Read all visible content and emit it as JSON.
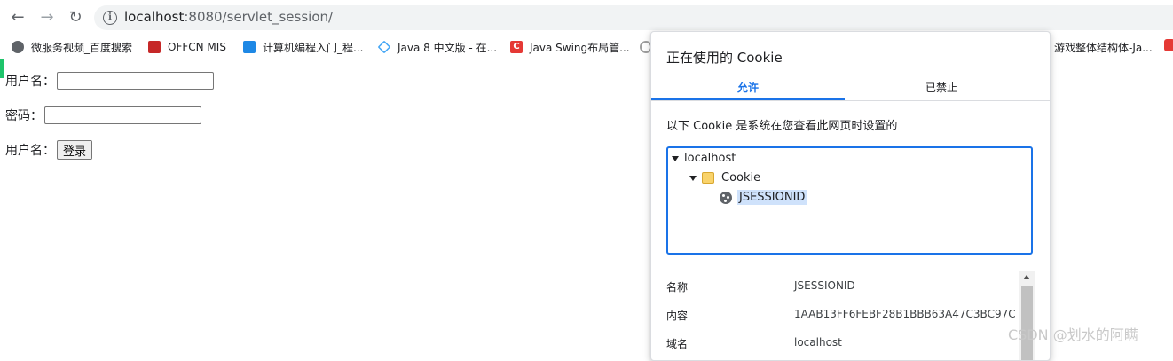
{
  "browser": {
    "url_host": "localhost",
    "url_port_path": ":8080/servlet_session/"
  },
  "bookmarks": [
    {
      "label": "微服务视频_百度搜索",
      "icon": "globe-icon"
    },
    {
      "label": "OFFCN MIS",
      "icon": "offcn-icon"
    },
    {
      "label": "计算机编程入门_程...",
      "icon": "computer-icon"
    },
    {
      "label": "Java 8 中文版 - 在...",
      "icon": "java-icon"
    },
    {
      "label": "Java Swing布局管...",
      "icon": "csdn-icon"
    },
    {
      "label": "游戏整体结构体-Ja...",
      "icon": "csdn-icon"
    }
  ],
  "form": {
    "username_label": "用户名：",
    "password_label": "密码：",
    "submit_row_label": "用户名：",
    "submit_button": "登录",
    "username_value": "",
    "password_value": ""
  },
  "cookie_dialog": {
    "title": "正在使用的 Cookie",
    "tab_allowed": "允许",
    "tab_blocked": "已禁止",
    "description": "以下 Cookie 是系统在您查看此网页时设置的",
    "tree": {
      "host": "localhost",
      "folder": "Cookie",
      "cookie_name": "JSESSIONID"
    },
    "details": [
      {
        "key": "名称",
        "value": "JSESSIONID"
      },
      {
        "key": "内容",
        "value": "1AAB13FF6FEBF28B1BBB63A47C3BC97C"
      },
      {
        "key": "域名",
        "value": "localhost"
      }
    ]
  },
  "watermark": "CSDN @划水的阿瞒"
}
